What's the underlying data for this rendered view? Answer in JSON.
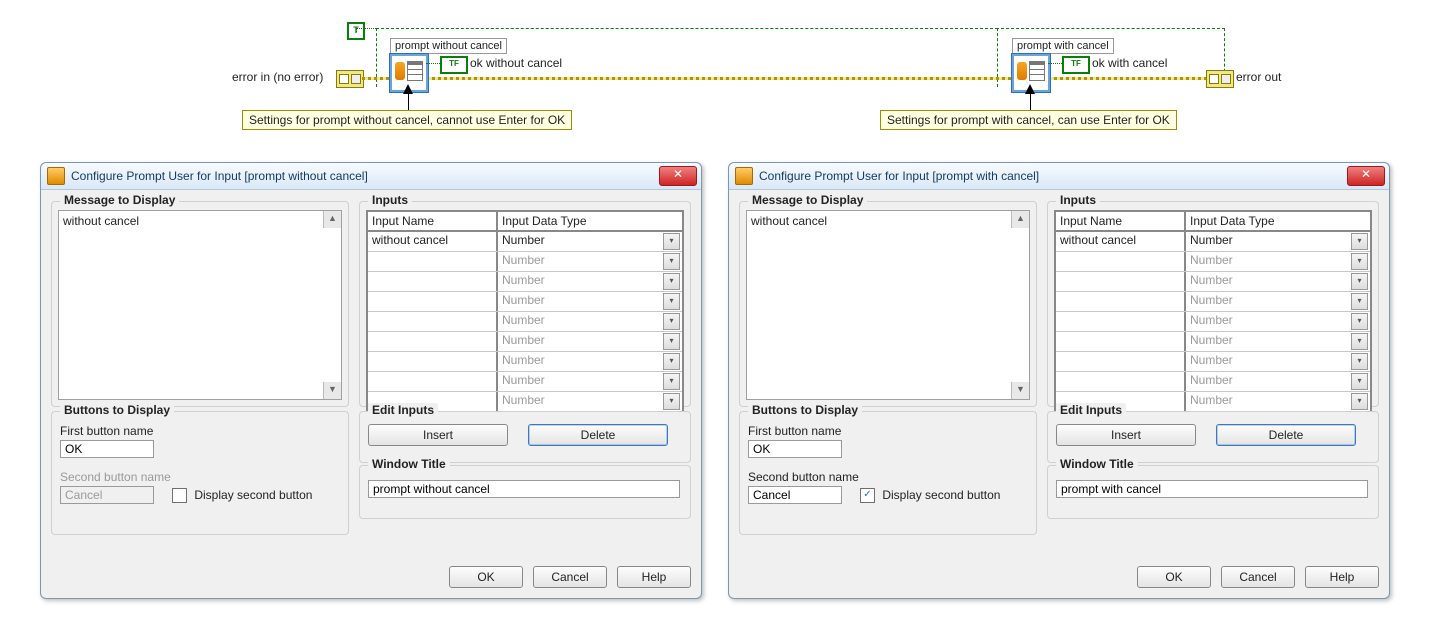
{
  "diagram": {
    "true_const": "T",
    "node1_label": "prompt without cancel",
    "node2_label": "prompt with cancel",
    "ok1_label": "ok without cancel",
    "ok2_label": "ok with cancel",
    "error_in": "error in (no error)",
    "error_out": "error out",
    "tf_text": "TF",
    "comment1": "Settings for prompt without cancel, cannot use Enter for OK",
    "comment2": "Settings for prompt with cancel, can use Enter for OK"
  },
  "dlg1": {
    "title": "Configure Prompt User for Input [prompt without cancel]",
    "msg_header": "Message to Display",
    "msg_text": "without cancel",
    "inputs_header": "Inputs",
    "col_name": "Input Name",
    "col_type": "Input Data Type",
    "rows": [
      {
        "name": "without cancel",
        "type": "Number",
        "dim": false
      },
      {
        "name": "",
        "type": "Number",
        "dim": true
      },
      {
        "name": "",
        "type": "Number",
        "dim": true
      },
      {
        "name": "",
        "type": "Number",
        "dim": true
      },
      {
        "name": "",
        "type": "Number",
        "dim": true
      },
      {
        "name": "",
        "type": "Number",
        "dim": true
      },
      {
        "name": "",
        "type": "Number",
        "dim": true
      },
      {
        "name": "",
        "type": "Number",
        "dim": true
      },
      {
        "name": "",
        "type": "Number",
        "dim": true
      }
    ],
    "buttons_header": "Buttons to Display",
    "first_lbl": "First button name",
    "first_val": "OK",
    "second_lbl": "Second button name",
    "second_val": "Cancel",
    "display_second": "Display second button",
    "second_checked": false,
    "edit_header": "Edit Inputs",
    "insert": "Insert",
    "delete": "Delete",
    "wtitle_header": "Window Title",
    "wtitle_val": "prompt without cancel",
    "ok": "OK",
    "cancel": "Cancel",
    "help": "Help"
  },
  "dlg2": {
    "title": "Configure Prompt User for Input [prompt with cancel]",
    "msg_header": "Message to Display",
    "msg_text": "without cancel",
    "inputs_header": "Inputs",
    "col_name": "Input Name",
    "col_type": "Input Data Type",
    "rows": [
      {
        "name": "without cancel",
        "type": "Number",
        "dim": false
      },
      {
        "name": "",
        "type": "Number",
        "dim": true
      },
      {
        "name": "",
        "type": "Number",
        "dim": true
      },
      {
        "name": "",
        "type": "Number",
        "dim": true
      },
      {
        "name": "",
        "type": "Number",
        "dim": true
      },
      {
        "name": "",
        "type": "Number",
        "dim": true
      },
      {
        "name": "",
        "type": "Number",
        "dim": true
      },
      {
        "name": "",
        "type": "Number",
        "dim": true
      },
      {
        "name": "",
        "type": "Number",
        "dim": true
      }
    ],
    "buttons_header": "Buttons to Display",
    "first_lbl": "First button name",
    "first_val": "OK",
    "second_lbl": "Second button name",
    "second_val": "Cancel",
    "display_second": "Display second button",
    "second_checked": true,
    "edit_header": "Edit Inputs",
    "insert": "Insert",
    "delete": "Delete",
    "wtitle_header": "Window Title",
    "wtitle_val": "prompt with cancel",
    "ok": "OK",
    "cancel": "Cancel",
    "help": "Help"
  }
}
